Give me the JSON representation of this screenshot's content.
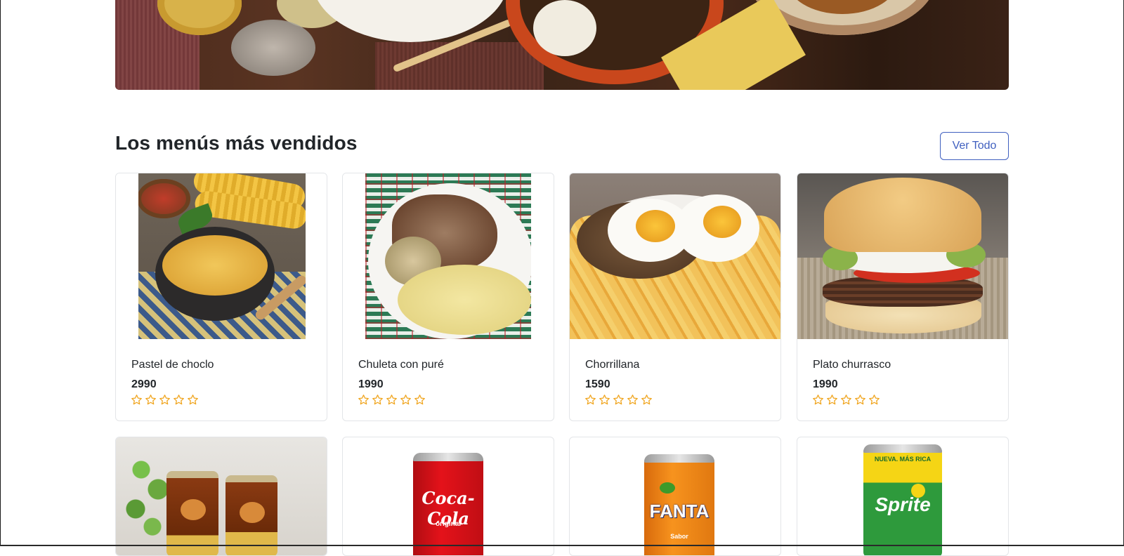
{
  "section": {
    "title": "Los menús más vendidos",
    "view_all_label": "Ver Todo"
  },
  "products": [
    {
      "name": "Pastel de choclo",
      "price": "2990",
      "rating": 0,
      "max_rating": 5,
      "image": "pastel-de-choclo"
    },
    {
      "name": "Chuleta con puré",
      "price": "1990",
      "rating": 0,
      "max_rating": 5,
      "image": "chuleta-con-pure"
    },
    {
      "name": "Chorrillana",
      "price": "1590",
      "rating": 0,
      "max_rating": 5,
      "image": "chorrillana"
    },
    {
      "name": "Plato churrasco",
      "price": "1990",
      "rating": 0,
      "max_rating": 5,
      "image": "churrasco"
    }
  ],
  "second_row": [
    {
      "image": "te-con-mote"
    },
    {
      "image": "coca-cola-can",
      "can_text": "Coca-Cola",
      "can_subtext": "original"
    },
    {
      "image": "fanta-can",
      "can_text": "FANTA",
      "can_subtext": "Sabor"
    },
    {
      "image": "sprite-can",
      "can_text": "Sprite",
      "can_subtext": "NUEVA. MÁS RICA"
    }
  ],
  "colors": {
    "accent": "#3f5fbf",
    "star": "#f0a41c",
    "border": "#e3e5e8",
    "text": "#212529"
  }
}
